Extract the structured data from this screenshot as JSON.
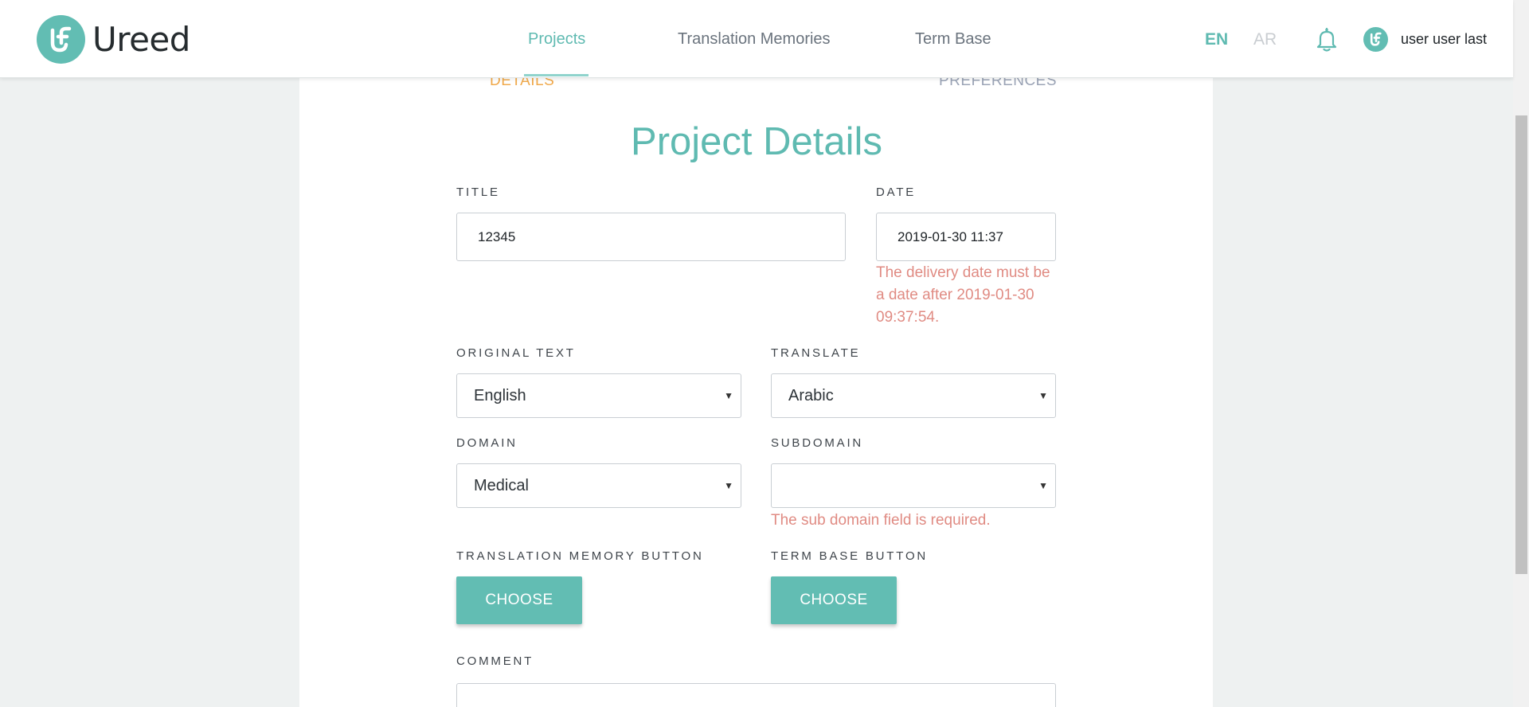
{
  "app": {
    "brand": "Ureed"
  },
  "nav": {
    "items": [
      {
        "label": "Projects",
        "active": true
      },
      {
        "label": "Translation Memories",
        "active": false
      },
      {
        "label": "Term Base",
        "active": false
      }
    ]
  },
  "language": {
    "en": "EN",
    "ar": "AR",
    "selected": "EN"
  },
  "user": {
    "name": "user user last"
  },
  "stepper": {
    "current": "DETAILS",
    "next": "PREFERENCES"
  },
  "form": {
    "heading": "Project Details",
    "title": {
      "label": "TITLE",
      "value": "12345"
    },
    "date": {
      "label": "DATE",
      "value": "2019-01-30 11:37",
      "error": "The delivery date must be a date after 2019-01-30 09:37:54."
    },
    "original_text": {
      "label": "ORIGINAL TEXT",
      "value": "English"
    },
    "translate": {
      "label": "TRANSLATE",
      "value": "Arabic"
    },
    "domain": {
      "label": "DOMAIN",
      "value": "Medical"
    },
    "subdomain": {
      "label": "SUBDOMAIN",
      "value": "",
      "error": "The sub domain field is required."
    },
    "translation_memory": {
      "label": "TRANSLATION MEMORY BUTTON",
      "button": "CHOOSE"
    },
    "term_base": {
      "label": "TERM BASE BUTTON",
      "button": "CHOOSE"
    },
    "comment": {
      "label": "COMMENT",
      "value": ""
    }
  },
  "colors": {
    "accent": "#5fbab1",
    "error": "#e08b83",
    "step_active": "#f0a94b",
    "background": "#eef1f1"
  }
}
